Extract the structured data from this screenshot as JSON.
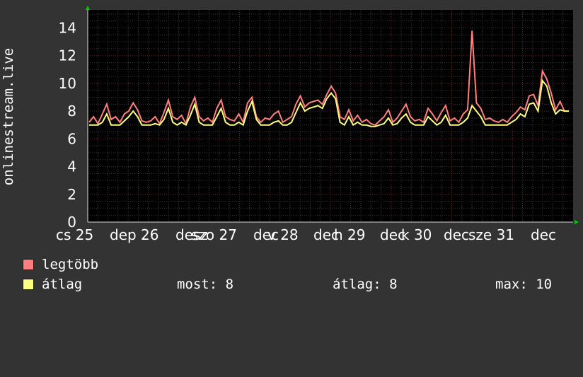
{
  "chart_data": {
    "type": "line",
    "ylabel": "onlinestream.live",
    "ylim": [
      0,
      15.3
    ],
    "y_ticks": [
      "0",
      "2",
      "4",
      "6",
      "8",
      "10",
      "12",
      "14"
    ],
    "x_ticks": [
      "cs 25",
      "dep 26",
      "desz",
      "szo 27",
      "dec",
      "v 28",
      "dec",
      "h 29",
      "dec",
      "k 30",
      "dec",
      "sze 31",
      "dec"
    ],
    "grid": true,
    "series": [
      {
        "name": "legtöbb",
        "color": "#ff7f7f",
        "values": [
          7.2,
          7.6,
          7.1,
          7.8,
          8.5,
          7.4,
          7.6,
          7.2,
          7.8,
          8.0,
          8.6,
          8.1,
          7.3,
          7.2,
          7.3,
          7.6,
          7.1,
          7.9,
          8.8,
          7.6,
          7.4,
          7.7,
          7.1,
          8.3,
          9.0,
          7.6,
          7.3,
          7.5,
          7.2,
          8.2,
          8.8,
          7.6,
          7.4,
          7.3,
          7.8,
          7.2,
          8.6,
          9.0,
          7.6,
          7.2,
          7.5,
          7.4,
          7.8,
          8.0,
          7.2,
          7.4,
          7.6,
          8.5,
          9.1,
          8.3,
          8.6,
          8.7,
          8.8,
          8.5,
          9.2,
          9.8,
          9.3,
          7.6,
          7.4,
          8.1,
          7.3,
          7.7,
          7.2,
          7.4,
          7.1,
          7.0,
          7.3,
          7.6,
          8.1,
          7.2,
          7.5,
          8.0,
          8.5,
          7.6,
          7.3,
          7.4,
          7.2,
          8.2,
          7.8,
          7.3,
          7.9,
          8.4,
          7.3,
          7.5,
          7.2,
          7.8,
          8.1,
          13.8,
          8.6,
          8.2,
          7.4,
          7.5,
          7.3,
          7.2,
          7.4,
          7.2,
          7.6,
          7.9,
          8.3,
          8.1,
          9.1,
          9.2,
          8.4,
          10.9,
          10.3,
          9.3,
          8.1,
          8.7,
          8.0,
          8.0
        ]
      },
      {
        "name": "átlag",
        "color": "#ffff7f",
        "values": [
          7.0,
          7.0,
          7.0,
          7.2,
          7.8,
          7.0,
          7.0,
          7.0,
          7.3,
          7.6,
          8.0,
          7.6,
          7.0,
          7.0,
          7.0,
          7.1,
          7.0,
          7.4,
          8.2,
          7.2,
          7.0,
          7.2,
          7.0,
          7.7,
          8.5,
          7.2,
          7.0,
          7.0,
          7.0,
          7.6,
          8.2,
          7.2,
          7.0,
          7.0,
          7.2,
          7.0,
          8.0,
          8.7,
          7.4,
          7.0,
          7.0,
          7.0,
          7.2,
          7.3,
          7.0,
          7.0,
          7.2,
          7.9,
          8.6,
          8.0,
          8.2,
          8.3,
          8.4,
          8.2,
          8.9,
          9.3,
          8.9,
          7.2,
          7.0,
          7.6,
          7.0,
          7.2,
          7.0,
          7.0,
          6.9,
          6.9,
          7.0,
          7.1,
          7.5,
          7.0,
          7.1,
          7.5,
          7.8,
          7.2,
          7.0,
          7.0,
          7.0,
          7.6,
          7.3,
          7.0,
          7.2,
          7.7,
          7.0,
          7.0,
          7.0,
          7.2,
          7.5,
          8.4,
          8.0,
          7.6,
          7.0,
          7.0,
          7.0,
          7.0,
          7.0,
          7.0,
          7.2,
          7.4,
          7.8,
          7.6,
          8.5,
          8.6,
          8.0,
          10.2,
          9.8,
          8.6,
          7.8,
          8.1,
          8.0,
          8.0
        ]
      }
    ]
  },
  "legend": {
    "max_label": "legtöbb",
    "avg_label": "átlag",
    "stats": {
      "current": "most: 8",
      "average": "átlag: 8",
      "maximum": "max: 10"
    }
  }
}
